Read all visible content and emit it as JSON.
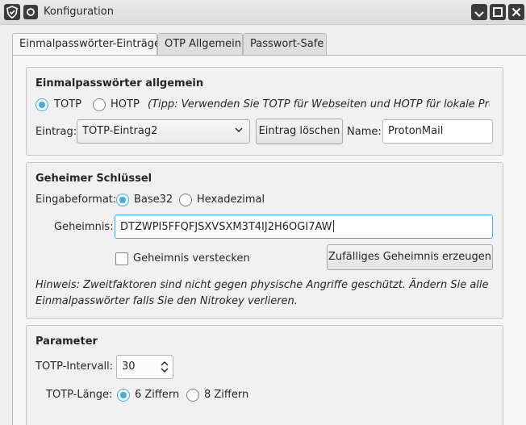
{
  "window": {
    "title": "Konfiguration",
    "app_icon": "shield-icon",
    "controls": {
      "minimize": "minimize-icon",
      "maximize": "maximize-icon",
      "close": "close-icon"
    }
  },
  "tabs": [
    {
      "label": "Einmalpasswörter-Einträge",
      "active": true
    },
    {
      "label": "OTP Allgemein",
      "active": false
    },
    {
      "label": "Passwort-Safe",
      "active": false
    }
  ],
  "otp_general": {
    "title": "Einmalpasswörter allgemein",
    "radio_totp": "TOTP",
    "radio_hotp": "HOTP",
    "selected": "TOTP",
    "tip": "(Tipp: Verwenden Sie TOTP für Webseiten und HOTP für lokale Programme)",
    "entry_label": "Eintrag:",
    "entry_value": "TOTP-Eintrag2",
    "delete_button": "Eintrag löschen",
    "name_label": "Name:",
    "name_value": "ProtonMail"
  },
  "secret": {
    "title": "Geheimer Schlüssel",
    "format_label": "Eingabeformat:",
    "format_base32": "Base32",
    "format_hex": "Hexadezimal",
    "format_selected": "Base32",
    "secret_label": "Geheimnis:",
    "secret_value": "DTZWPI5FFQFJSXVSXM3T4IJ2H6OGI7AW",
    "hide_label": "Geheimnis verstecken",
    "hide_checked": false,
    "random_button": "Zufälliges Geheimnis erzeugen",
    "hint": "Hinweis: Zweitfaktoren sind nicht gegen physische Angriffe geschützt. Ändern Sie alle Einmalpasswörter falls Sie den Nitrokey verlieren."
  },
  "params": {
    "title": "Parameter",
    "interval_label": "TOTP-Intervall:",
    "interval_value": "30",
    "length_label": "TOTP-Länge:",
    "length_6": "6 Ziffern",
    "length_8": "8 Ziffern",
    "length_selected": "6 Ziffern"
  },
  "colors": {
    "accent": "#3daee9",
    "window_bg": "#efefef"
  }
}
